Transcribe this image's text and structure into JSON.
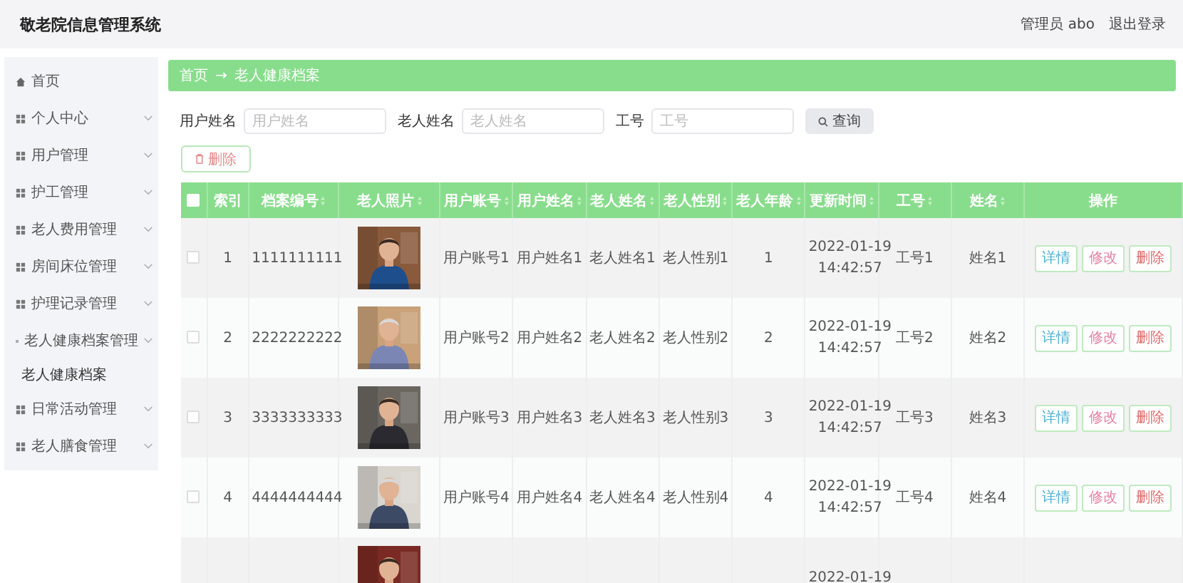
{
  "header": {
    "title": "敬老院信息管理系统",
    "user": "管理员 abo",
    "logout": "退出登录"
  },
  "sidebar": {
    "items": [
      {
        "label": "首页",
        "expandable": false
      },
      {
        "label": "个人中心",
        "expandable": true
      },
      {
        "label": "用户管理",
        "expandable": true
      },
      {
        "label": "护工管理",
        "expandable": true
      },
      {
        "label": "老人费用管理",
        "expandable": true
      },
      {
        "label": "房间床位管理",
        "expandable": true
      },
      {
        "label": "护理记录管理",
        "expandable": true
      },
      {
        "label": "老人健康档案管理",
        "expandable": true,
        "children": [
          {
            "label": "老人健康档案"
          }
        ]
      },
      {
        "label": "日常活动管理",
        "expandable": true
      },
      {
        "label": "老人膳食管理",
        "expandable": true
      }
    ]
  },
  "breadcrumb": {
    "items": [
      "首页",
      "老人健康档案"
    ],
    "separator": "→"
  },
  "search": {
    "fields": [
      {
        "label": "用户姓名",
        "placeholder": "用户姓名"
      },
      {
        "label": "老人姓名",
        "placeholder": "老人姓名"
      },
      {
        "label": "工号",
        "placeholder": "工号"
      }
    ],
    "button": "查询"
  },
  "delete_button": "删除",
  "table": {
    "select_all_checked": false,
    "columns": [
      {
        "label": "索引",
        "sortable": false
      },
      {
        "label": "档案编号",
        "sortable": true
      },
      {
        "label": "老人照片",
        "sortable": true
      },
      {
        "label": "用户账号",
        "sortable": true
      },
      {
        "label": "用户姓名",
        "sortable": true
      },
      {
        "label": "老人姓名",
        "sortable": true
      },
      {
        "label": "老人性别",
        "sortable": true
      },
      {
        "label": "老人年龄",
        "sortable": true
      },
      {
        "label": "更新时间",
        "sortable": true
      },
      {
        "label": "工号",
        "sortable": true
      },
      {
        "label": "姓名",
        "sortable": true
      },
      {
        "label": "操作",
        "sortable": false
      }
    ],
    "rows": [
      {
        "checked": false,
        "cells": [
          "1",
          "1111111111",
          null,
          "用户账号1",
          "用户姓名1",
          "老人姓名1",
          "老人性别1",
          "1",
          [
            "2022-01-19",
            "14:42:57"
          ],
          "工号1",
          "姓名1"
        ],
        "actions": [
          {
            "label": "详情",
            "kind": "view"
          },
          {
            "label": "修改",
            "kind": "edit"
          },
          {
            "label": "删除",
            "kind": "delete"
          }
        ]
      },
      {
        "checked": false,
        "cells": [
          "2",
          "2222222222",
          null,
          "用户账号2",
          "用户姓名2",
          "老人姓名2",
          "老人性别2",
          "2",
          [
            "2022-01-19",
            "14:42:57"
          ],
          "工号2",
          "姓名2"
        ],
        "actions": [
          {
            "label": "详情",
            "kind": "view"
          },
          {
            "label": "修改",
            "kind": "edit"
          },
          {
            "label": "删除",
            "kind": "delete"
          }
        ]
      },
      {
        "checked": false,
        "cells": [
          "3",
          "3333333333",
          null,
          "用户账号3",
          "用户姓名3",
          "老人姓名3",
          "老人性别3",
          "3",
          [
            "2022-01-19",
            "14:42:57"
          ],
          "工号3",
          "姓名3"
        ],
        "actions": [
          {
            "label": "详情",
            "kind": "view"
          },
          {
            "label": "修改",
            "kind": "edit"
          },
          {
            "label": "删除",
            "kind": "delete"
          }
        ]
      },
      {
        "checked": false,
        "cells": [
          "4",
          "4444444444",
          null,
          "用户账号4",
          "用户姓名4",
          "老人姓名4",
          "老人性别4",
          "4",
          [
            "2022-01-19",
            "14:42:57"
          ],
          "工号4",
          "姓名4"
        ],
        "actions": [
          {
            "label": "详情",
            "kind": "view"
          },
          {
            "label": "修改",
            "kind": "edit"
          },
          {
            "label": "删除",
            "kind": "delete"
          }
        ]
      },
      {
        "cells": [
          null,
          null,
          null,
          null,
          null,
          null,
          null,
          null,
          [
            "2022-01-19"
          ],
          null,
          null
        ]
      }
    ]
  }
}
